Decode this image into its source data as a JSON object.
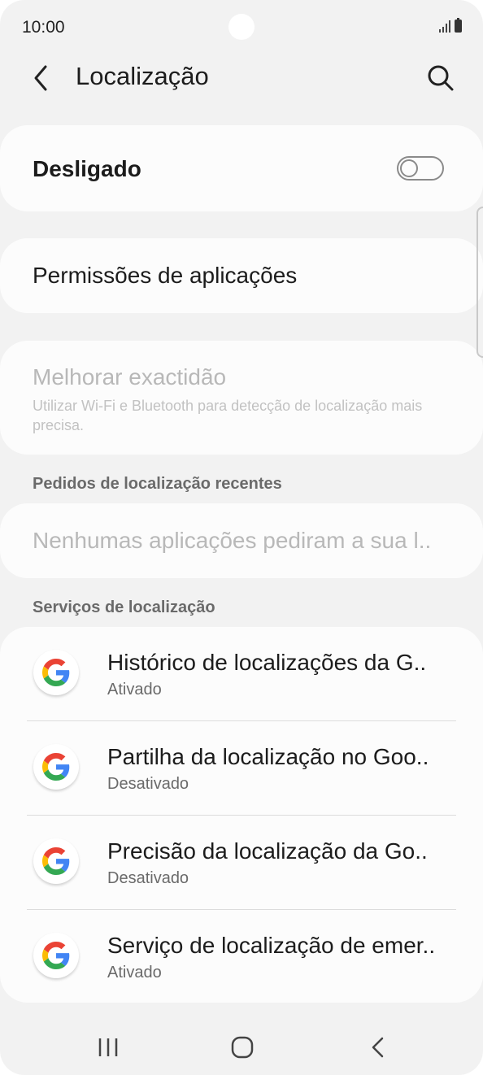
{
  "status_bar": {
    "time": "10:00"
  },
  "header": {
    "title": "Localização"
  },
  "location_toggle": {
    "label": "Desligado",
    "state": "off"
  },
  "app_permissions": {
    "label": "Permissões de aplicações"
  },
  "accuracy": {
    "title": "Melhorar exactidão",
    "description": "Utilizar Wi-Fi e Bluetooth para detecção de localização mais precisa."
  },
  "recent_requests": {
    "section_label": "Pedidos de localização recentes",
    "empty_text": "Nenhumas aplicações pediram a sua l.."
  },
  "location_services": {
    "section_label": "Serviços de localização",
    "items": [
      {
        "title": "Histórico de localizações da G..",
        "status": "Ativado"
      },
      {
        "title": "Partilha da localização no Goo..",
        "status": "Desativado"
      },
      {
        "title": "Precisão da localização da Go..",
        "status": "Desativado"
      },
      {
        "title": "Serviço de localização de emer..",
        "status": "Ativado"
      }
    ]
  },
  "colors": {
    "background": "#f2f2f2",
    "card": "#fcfcfc",
    "google_blue": "#4285F4",
    "google_red": "#EA4335",
    "google_yellow": "#FBBC05",
    "google_green": "#34A853"
  },
  "icons": {
    "back": "chevron-left-icon",
    "search": "search-icon",
    "service": "google-g-icon",
    "nav_recent": "recent-apps-icon",
    "nav_home": "home-icon",
    "nav_back": "back-arrow-icon"
  }
}
